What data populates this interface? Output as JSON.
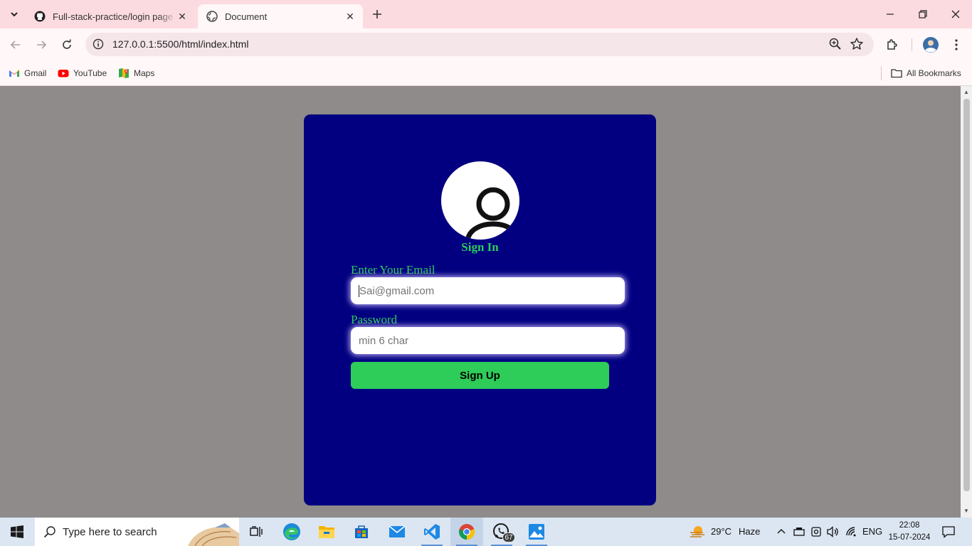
{
  "browser": {
    "tabs": [
      {
        "title": "Full-stack-practice/login page a",
        "active": false,
        "icon": "github-icon"
      },
      {
        "title": "Document",
        "active": true,
        "icon": "globe-icon"
      }
    ],
    "url": "127.0.0.1:5500/html/index.html",
    "bookmarks": [
      {
        "label": "Gmail",
        "icon": "gmail-icon"
      },
      {
        "label": "YouTube",
        "icon": "youtube-icon"
      },
      {
        "label": "Maps",
        "icon": "maps-icon"
      }
    ],
    "all_bookmarks_label": "All Bookmarks"
  },
  "page": {
    "heading": "Sign In",
    "email_label": "Enter Your Email",
    "email_placeholder": "Sai@gmail.com",
    "password_label": "Password",
    "password_placeholder": "min 6 char",
    "submit_label": "Sign Up"
  },
  "taskbar": {
    "search_placeholder": "Type here to search",
    "whatsapp_badge": "67",
    "weather_temp": "29°C",
    "weather_desc": "Haze",
    "language": "ENG",
    "time": "22:08",
    "date": "15-07-2024"
  },
  "colors": {
    "card_bg": "#020080",
    "accent_green": "#2ecc59",
    "page_bg": "#8e8b8a",
    "tabbar_bg": "#fcdbe0"
  }
}
